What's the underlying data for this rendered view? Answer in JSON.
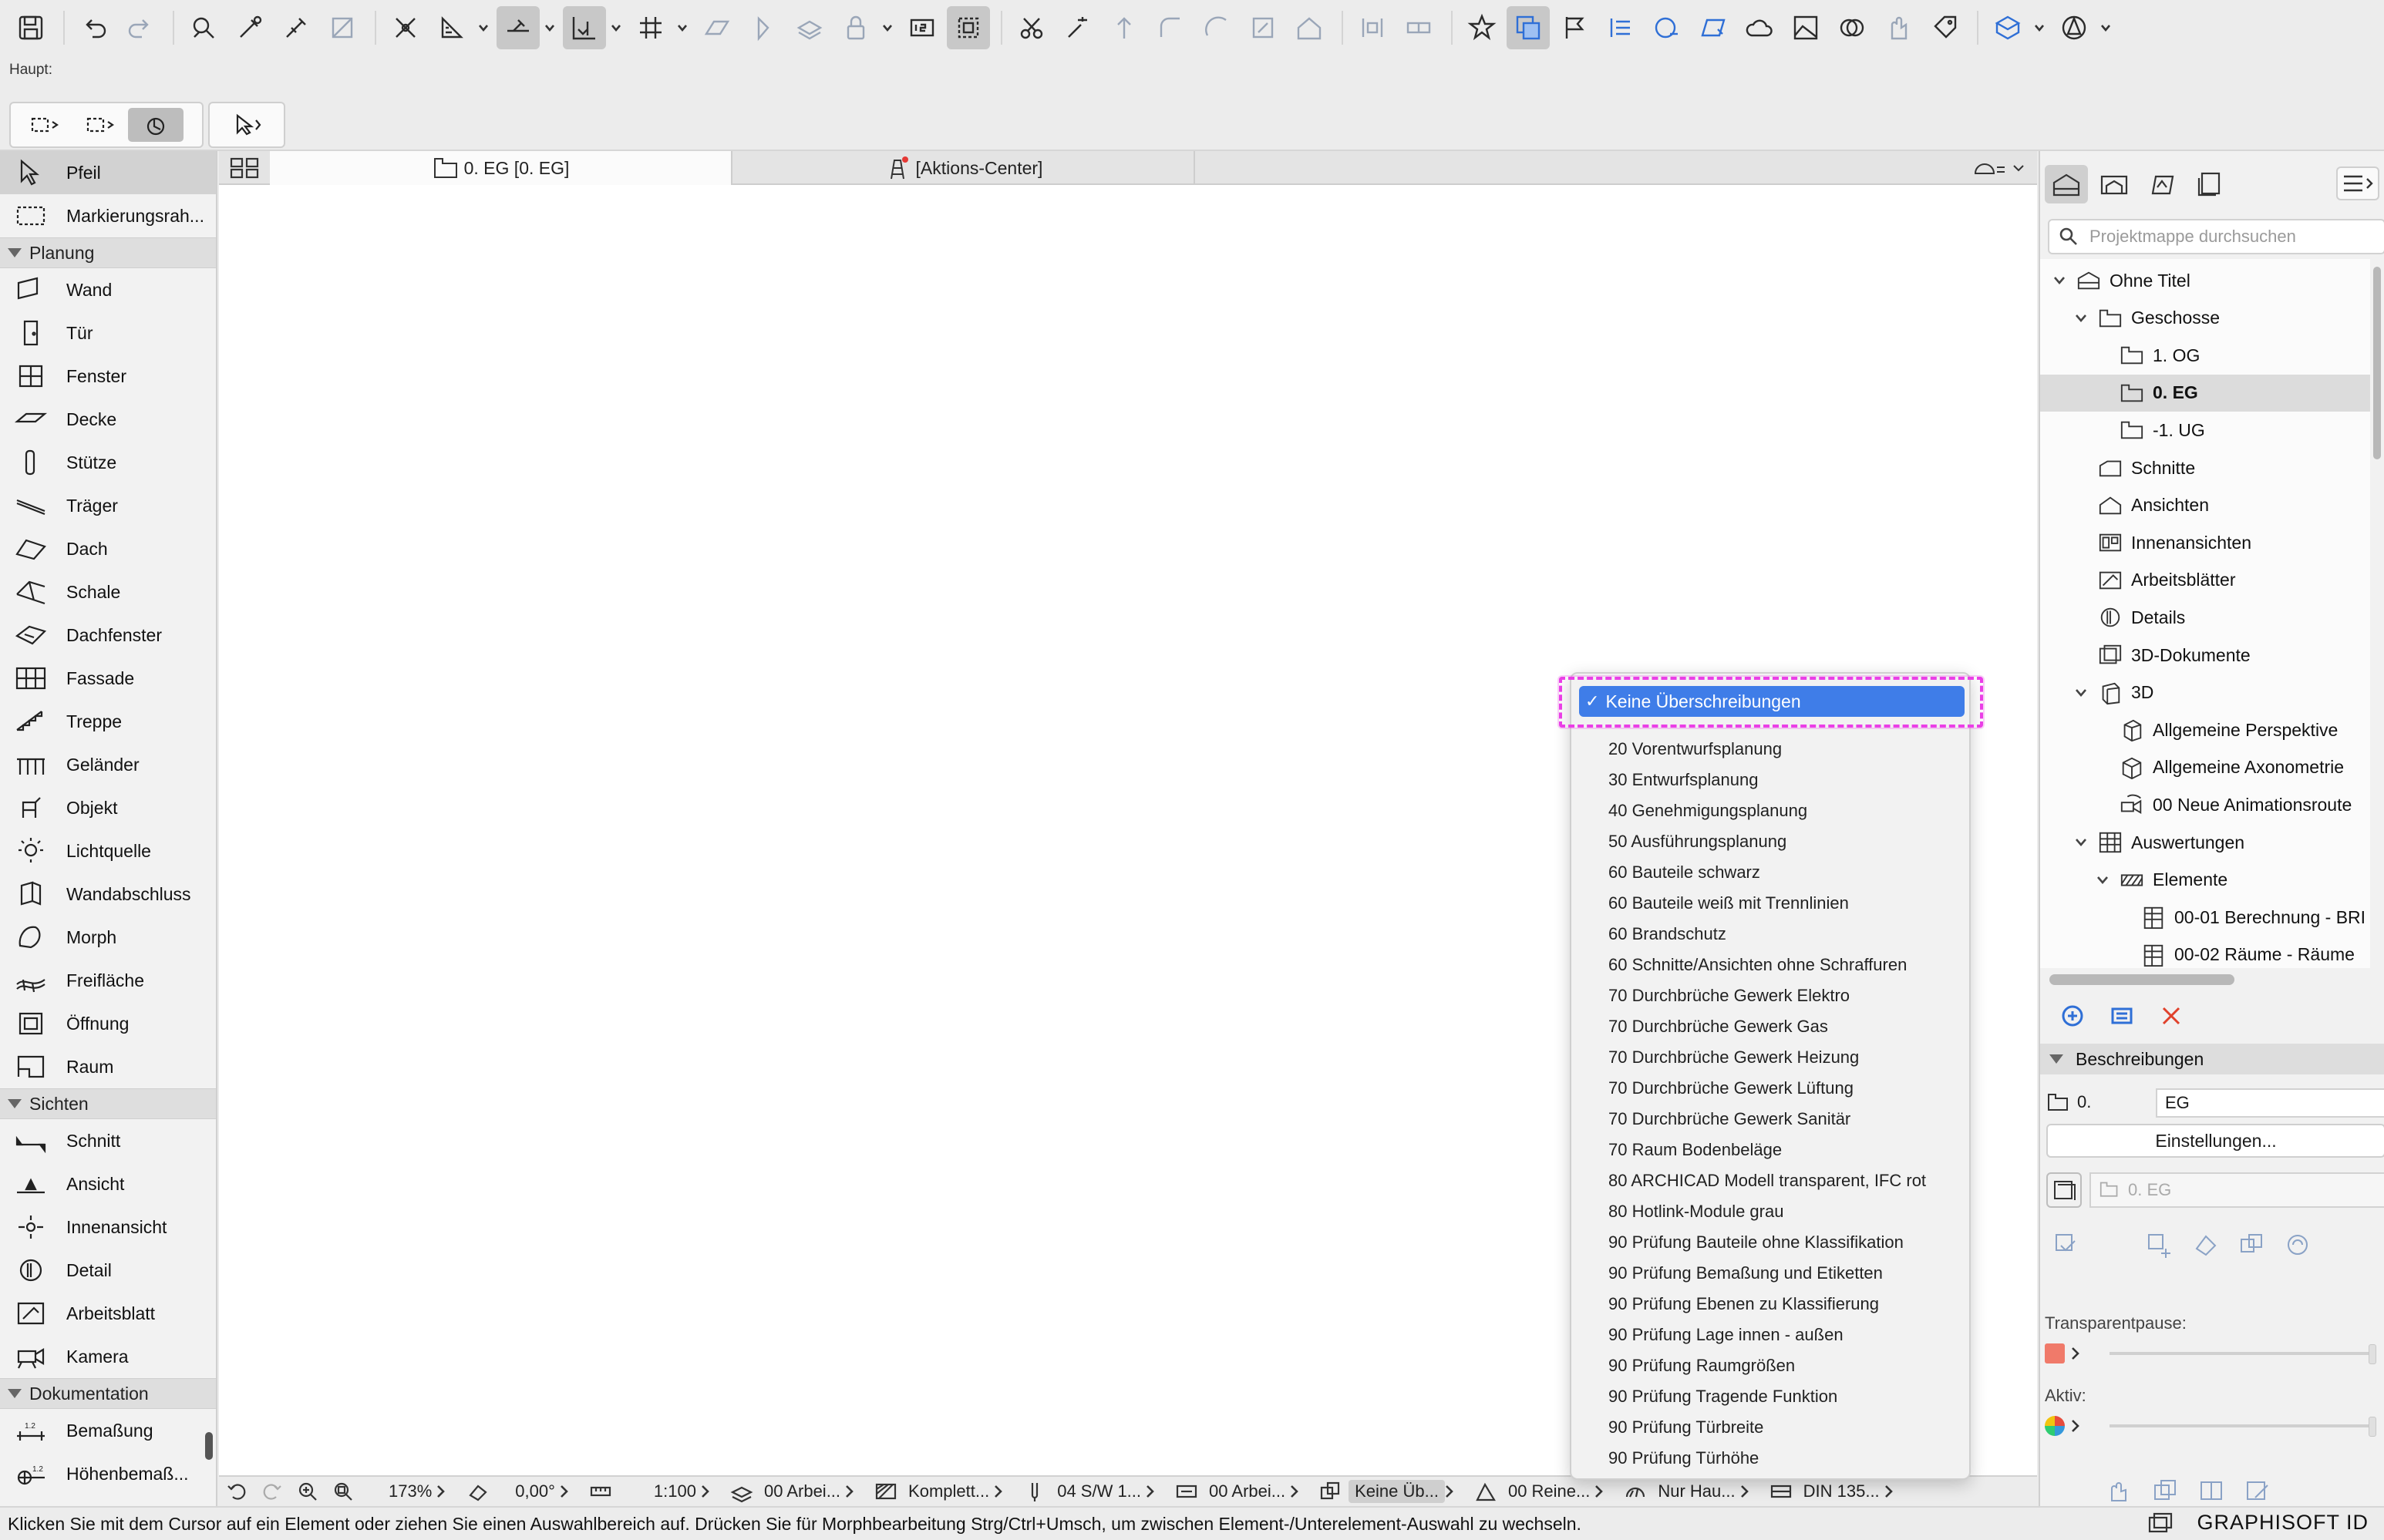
{
  "toolbar": {
    "icons": [
      "save-icon",
      "undo-icon",
      "redo-icon",
      "find-select-icon",
      "eyedropper-icon",
      "syringe-icon",
      "transform-icon",
      "snap-icon",
      "guide-icon",
      "measure-icon",
      "grid-snap-icon",
      "plane-icon",
      "lock-icon",
      "renumber-icon",
      "marquee-icon",
      "scissors-icon",
      "magic-wand-icon",
      "star-icon",
      "flag-icon"
    ]
  },
  "subbar": {
    "label": "Haupt:"
  },
  "palette": {
    "top_items": [
      {
        "label": "Pfeil",
        "icon": "arrow-icon"
      },
      {
        "label": "Markierungsrah...",
        "icon": "marquee-icon"
      }
    ],
    "categories": [
      {
        "label": "Planung",
        "items": [
          {
            "label": "Wand",
            "icon": "wall-icon"
          },
          {
            "label": "Tür",
            "icon": "door-icon"
          },
          {
            "label": "Fenster",
            "icon": "window-icon"
          },
          {
            "label": "Decke",
            "icon": "slab-icon"
          },
          {
            "label": "Stütze",
            "icon": "column-icon"
          },
          {
            "label": "Träger",
            "icon": "beam-icon"
          },
          {
            "label": "Dach",
            "icon": "roof-icon"
          },
          {
            "label": "Schale",
            "icon": "shell-icon"
          },
          {
            "label": "Dachfenster",
            "icon": "skylight-icon"
          },
          {
            "label": "Fassade",
            "icon": "curtain-wall-icon"
          },
          {
            "label": "Treppe",
            "icon": "stair-icon"
          },
          {
            "label": "Geländer",
            "icon": "railing-icon"
          },
          {
            "label": "Objekt",
            "icon": "object-icon"
          },
          {
            "label": "Lichtquelle",
            "icon": "lamp-icon"
          },
          {
            "label": "Wandabschluss",
            "icon": "wall-end-icon"
          },
          {
            "label": "Morph",
            "icon": "morph-icon"
          },
          {
            "label": "Freifläche",
            "icon": "mesh-icon"
          },
          {
            "label": "Öffnung",
            "icon": "opening-icon"
          },
          {
            "label": "Raum",
            "icon": "zone-icon"
          }
        ]
      },
      {
        "label": "Sichten",
        "items": [
          {
            "label": "Schnitt",
            "icon": "section-icon"
          },
          {
            "label": "Ansicht",
            "icon": "elevation-icon"
          },
          {
            "label": "Innenansicht",
            "icon": "interior-elevation-icon"
          },
          {
            "label": "Detail",
            "icon": "detail-icon"
          },
          {
            "label": "Arbeitsblatt",
            "icon": "worksheet-icon"
          },
          {
            "label": "Kamera",
            "icon": "camera-icon"
          }
        ]
      },
      {
        "label": "Dokumentation",
        "items": [
          {
            "label": "Bemaßung",
            "icon": "dimension-icon"
          },
          {
            "label": "Höhenbemaß...",
            "icon": "level-dimension-icon"
          }
        ]
      }
    ]
  },
  "tabs": [
    {
      "label": "0. EG [0. EG]",
      "icon": "floor-plan-icon"
    },
    {
      "label": "[Aktions-Center]",
      "icon": "action-center-icon"
    }
  ],
  "quickbar": {
    "zoom": "173%",
    "angle": "0,00°",
    "scale": "1:100",
    "layer_combo": "00 Arbei...",
    "model_view": "Komplett...",
    "pen_set": "04 S/W 1...",
    "dimension": "00 Arbei...",
    "override": "Keine Üb...",
    "renovation": "00 Reine...",
    "structure": "Nur Hau...",
    "paper": "DIN 135..."
  },
  "status": {
    "message": "Klicken Sie mit dem Cursor auf ein Element oder ziehen Sie einen Auswahlbereich auf. Drücken Sie für Morphbearbeitung Strg/Ctrl+Umsch, um zwischen Element-/Unterelement-Auswahl zu wechseln.",
    "brand": "GRAPHISOFT ID"
  },
  "navigator": {
    "search_placeholder": "Projektmappe durchsuchen",
    "tree": [
      {
        "label": "Ohne Titel",
        "level": 0,
        "expanded": true,
        "icon": "project-icon"
      },
      {
        "label": "Geschosse",
        "level": 1,
        "expanded": true,
        "icon": "stories-icon"
      },
      {
        "label": "1. OG",
        "level": 2,
        "icon": "story-icon"
      },
      {
        "label": "0. EG",
        "level": 2,
        "icon": "story-icon",
        "selected": true
      },
      {
        "label": "-1. UG",
        "level": 2,
        "icon": "story-icon"
      },
      {
        "label": "Schnitte",
        "level": 1,
        "icon": "sections-icon"
      },
      {
        "label": "Ansichten",
        "level": 1,
        "icon": "elevations-icon"
      },
      {
        "label": "Innenansichten",
        "level": 1,
        "icon": "interior-elevations-icon"
      },
      {
        "label": "Arbeitsblätter",
        "level": 1,
        "icon": "worksheets-icon"
      },
      {
        "label": "Details",
        "level": 1,
        "icon": "details-icon"
      },
      {
        "label": "3D-Dokumente",
        "level": 1,
        "icon": "3d-documents-icon"
      },
      {
        "label": "3D",
        "level": 1,
        "expanded": true,
        "icon": "3d-icon"
      },
      {
        "label": "Allgemeine Perspektive",
        "level": 2,
        "icon": "perspective-icon"
      },
      {
        "label": "Allgemeine Axonometrie",
        "level": 2,
        "icon": "axonometry-icon"
      },
      {
        "label": "00 Neue Animationsroute",
        "level": 2,
        "icon": "animation-route-icon"
      },
      {
        "label": "Auswertungen",
        "level": 1,
        "expanded": true,
        "icon": "schedules-icon"
      },
      {
        "label": "Elemente",
        "level": 2,
        "expanded": true,
        "icon": "elements-icon"
      },
      {
        "label": "00-01 Berechnung - BRI",
        "level": 3,
        "icon": "schedule-icon"
      },
      {
        "label": "00-02 Räume - Räume",
        "level": 3,
        "icon": "schedule-icon"
      }
    ],
    "section_title": "Beschreibungen",
    "desc_number": "0.",
    "desc_name": "EG",
    "settings_label": "Einstellungen...",
    "view_field": "0. EG",
    "transparent_label": "Transparentpause:",
    "active_label": "Aktiv:",
    "swatch_color": "#f07a6a"
  },
  "dropdown": {
    "selected": "Keine Überschreibungen",
    "items": [
      "20 Vorentwurfsplanung",
      "30 Entwurfsplanung",
      "40 Genehmigungsplanung",
      "50 Ausführungsplanung",
      "60 Bauteile schwarz",
      "60 Bauteile weiß mit Trennlinien",
      "60 Brandschutz",
      "60 Schnitte/Ansichten ohne Schraffuren",
      "70 Durchbrüche Gewerk Elektro",
      "70 Durchbrüche Gewerk Gas",
      "70 Durchbrüche Gewerk Heizung",
      "70 Durchbrüche Gewerk Lüftung",
      "70 Durchbrüche Gewerk Sanitär",
      "70 Raum Bodenbeläge",
      "80 ARCHICAD Modell transparent, IFC rot",
      "80 Hotlink-Module grau",
      "90 Prüfung Bauteile ohne Klassifikation",
      "90 Prüfung Bemaßung und Etiketten",
      "90 Prüfung Ebenen zu Klassifierung",
      "90 Prüfung Lage innen - außen",
      "90 Prüfung Raumgrößen",
      "90 Prüfung Tragende Funktion",
      "90 Prüfung Türbreite",
      "90 Prüfung Türhöhe"
    ],
    "highlight_color": "#ea3fe6",
    "selection_color": "#3f7de8"
  }
}
